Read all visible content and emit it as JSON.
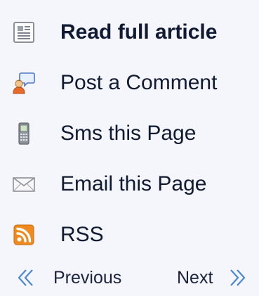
{
  "menu": {
    "items": [
      {
        "label": "Read full article",
        "icon": "newspaper-icon"
      },
      {
        "label": "Post a Comment",
        "icon": "comment-user-icon"
      },
      {
        "label": "Sms this Page",
        "icon": "mobile-phone-icon"
      },
      {
        "label": "Email this Page",
        "icon": "envelope-icon"
      },
      {
        "label": "RSS",
        "icon": "rss-icon"
      }
    ]
  },
  "pager": {
    "previous": "Previous",
    "next": "Next",
    "previous_icon": "double-chevron-left-icon",
    "next_icon": "double-chevron-right-icon"
  },
  "colors": {
    "background": "#f4f6fc",
    "text": "#111a33",
    "rss": "#f08a1e",
    "arrow": "#4c87d6"
  }
}
